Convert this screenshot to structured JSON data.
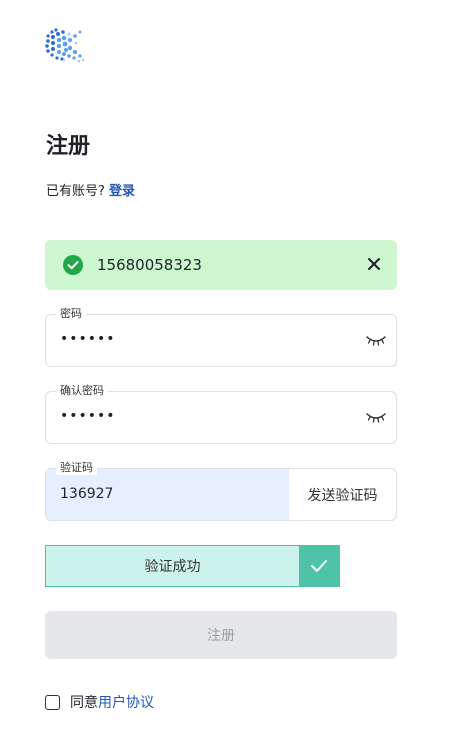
{
  "header": {
    "title": "注册"
  },
  "login_prompt": {
    "text": "已有账号?",
    "link": "登录"
  },
  "phone": {
    "value": "15680058323"
  },
  "password": {
    "label": "密码",
    "value": "••••••"
  },
  "confirm_password": {
    "label": "确认密码",
    "value": "••••••"
  },
  "code": {
    "label": "验证码",
    "value": "136927",
    "send_label": "发送验证码"
  },
  "verify": {
    "label": "验证成功"
  },
  "submit": {
    "label": "注册"
  },
  "agreement": {
    "text": "同意",
    "link": "用户协议"
  },
  "colors": {
    "accent": "#2457b8",
    "success_bg": "#ccf7cf",
    "success": "#22a84a",
    "slider": "#4fc3a7"
  }
}
